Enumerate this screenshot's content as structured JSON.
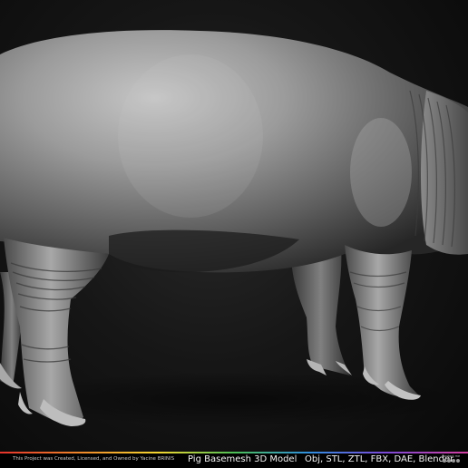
{
  "scene": {
    "subject": "pig-sculpt",
    "background_color": "#111111",
    "model_color": "#9a9a9a"
  },
  "footer": {
    "credit": "This Project was Created, Licensed, and Owned by Yacine BRINIS",
    "title": "Pig Basemesh 3D Model",
    "formats": "Obj, STL, ZTL, FBX, DAE, Blender",
    "contact_label": "Contact me",
    "social_icons": [
      "social-icon",
      "social-icon",
      "social-icon",
      "social-icon"
    ]
  }
}
